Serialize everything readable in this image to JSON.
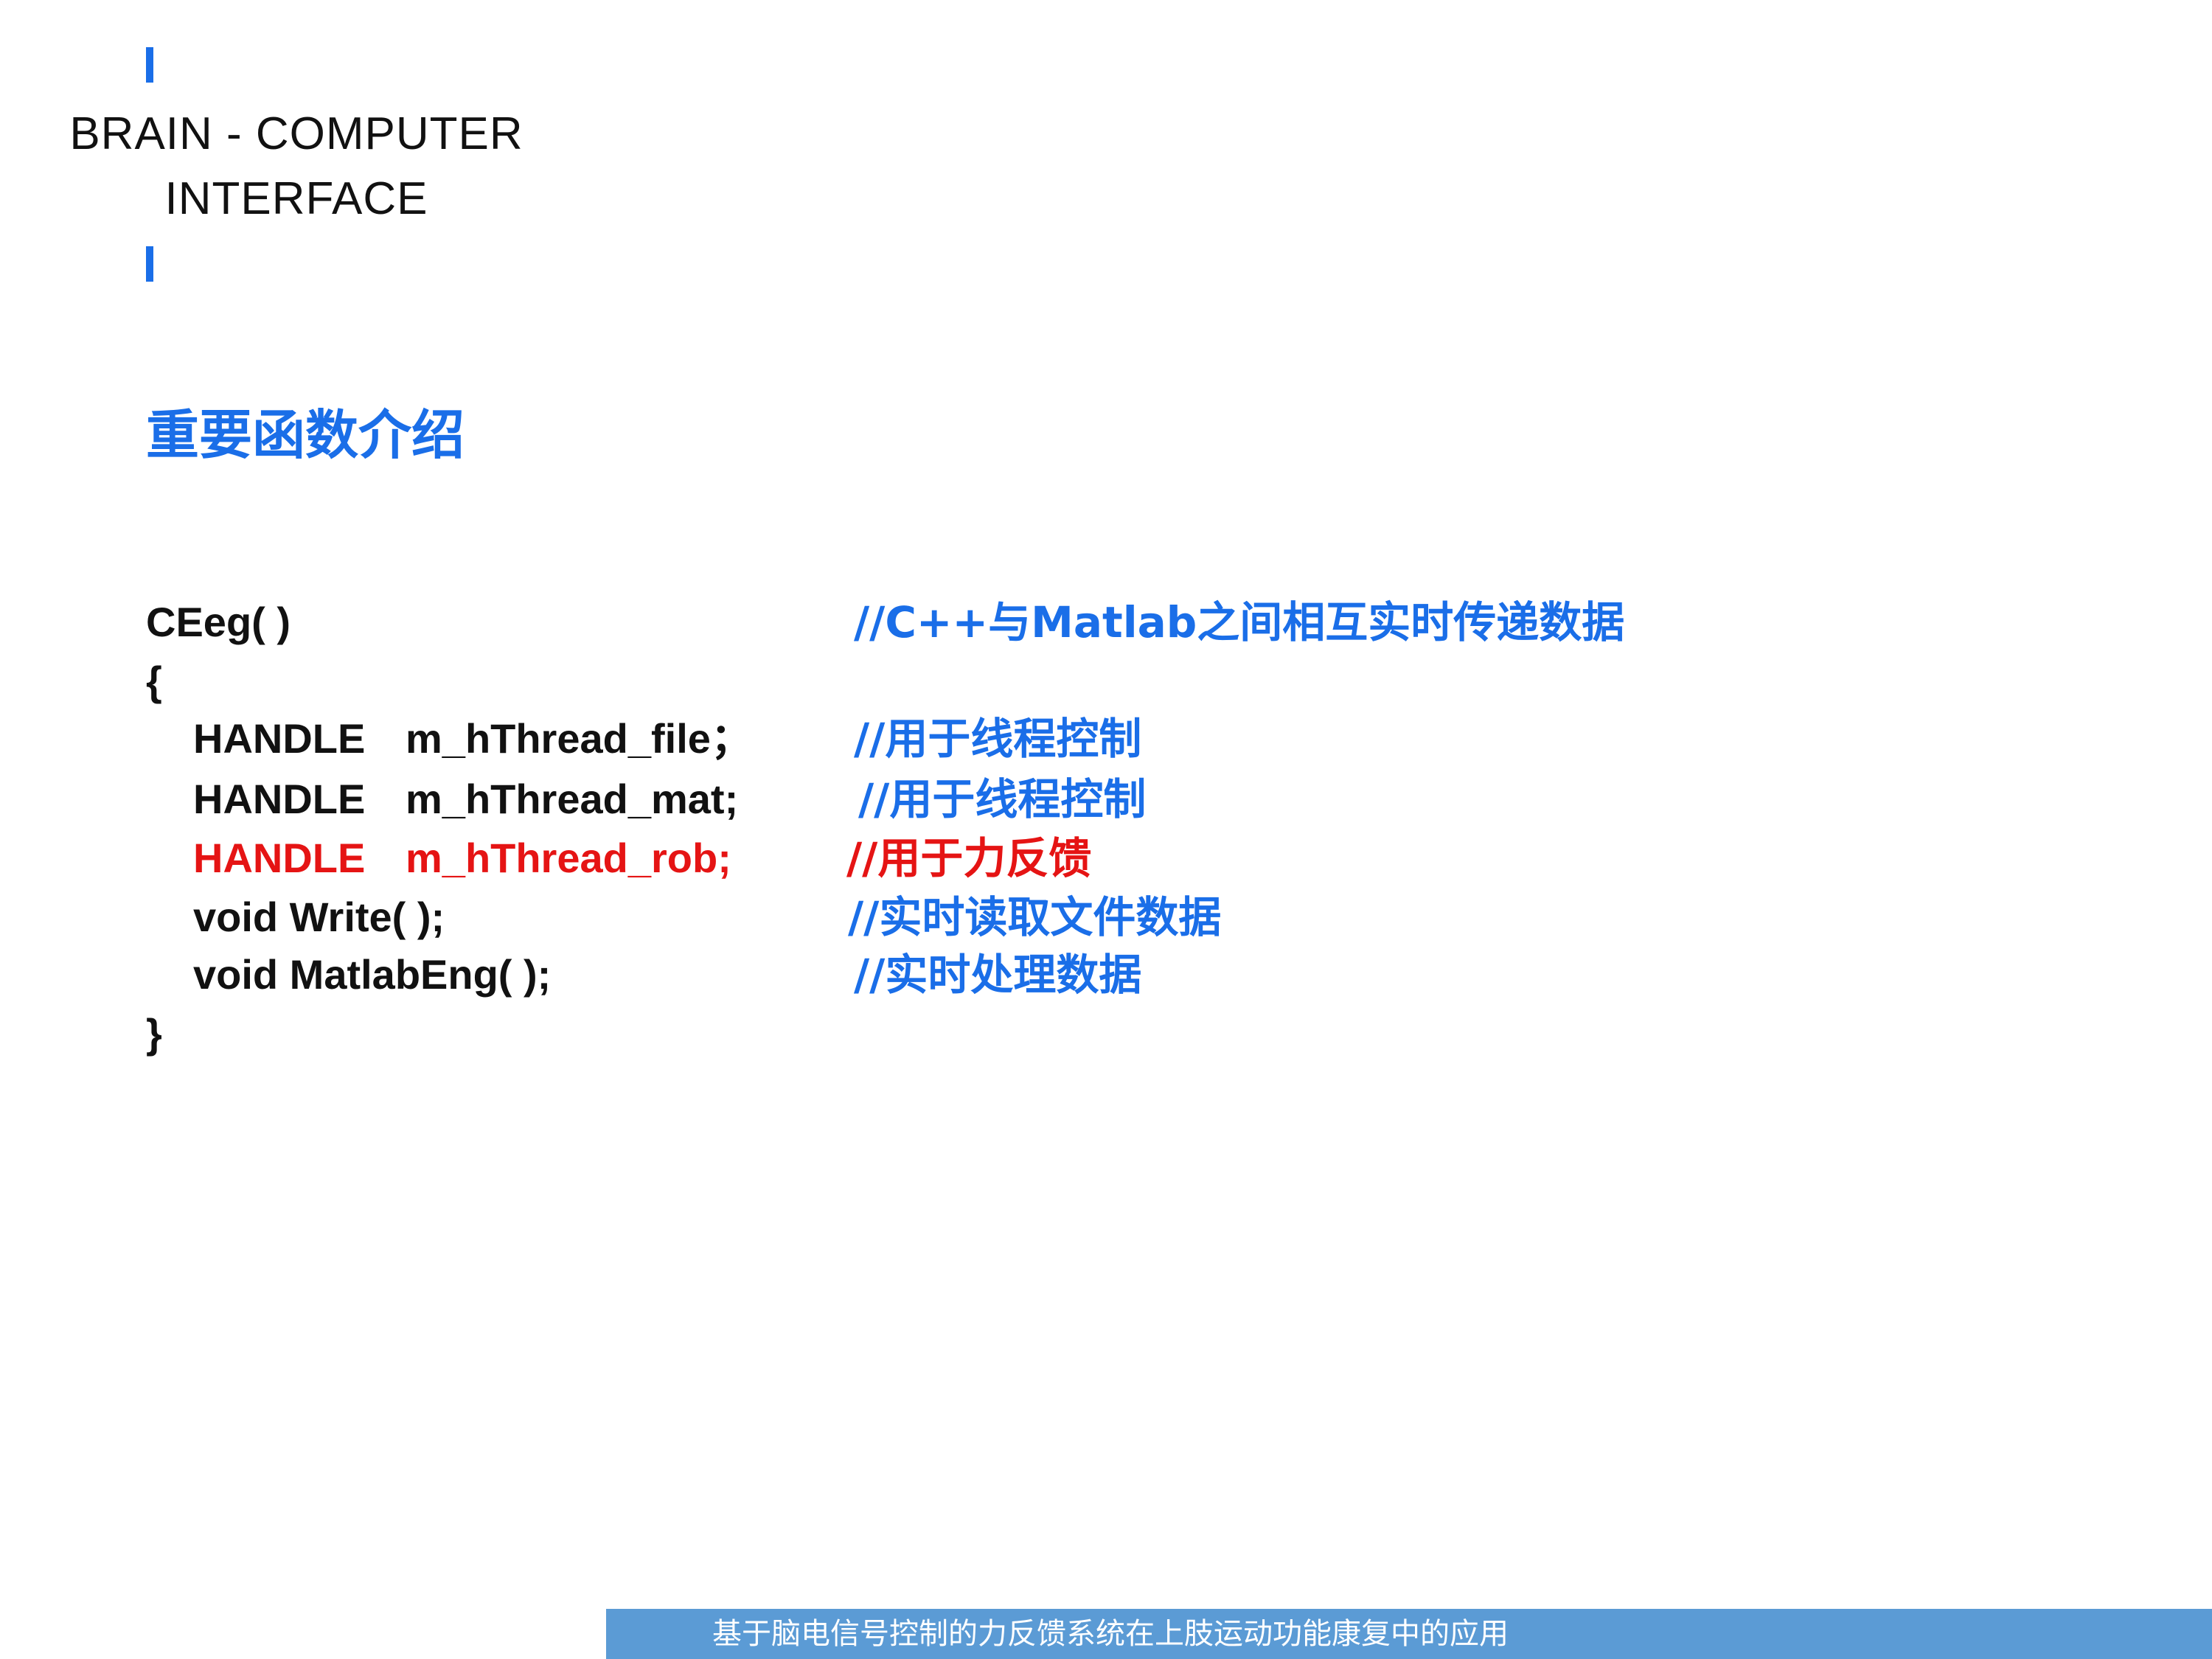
{
  "header": {
    "brand_line1": "BRAIN - COMPUTER",
    "brand_line2": "INTERFACE"
  },
  "section": {
    "title": "重要函数介绍"
  },
  "code": {
    "lines": [
      {
        "text": "CEeg( )",
        "comment": "//C++与Matlab之间相互实时传递数据"
      },
      {
        "text": "{",
        "comment": ""
      },
      {
        "keyword": "HANDLE",
        "member": "m_hThread_file；",
        "comment": "//用于线程控制"
      },
      {
        "keyword": "HANDLE",
        "member": "m_hThread_mat;",
        "comment": "//用于线程控制"
      },
      {
        "keyword": "HANDLE",
        "member": "m_hThread_rob;",
        "comment": "//用于力反馈",
        "highlight": "#e51414"
      },
      {
        "text": "void Write( );",
        "comment": "//实时读取文件数据"
      },
      {
        "text": "void MatlabEng( );",
        "comment": "//实时处理数据"
      },
      {
        "text": "}",
        "comment": ""
      }
    ]
  },
  "footer": {
    "caption": "基于脑电信号控制的力反馈系统在上肢运动功能康复中的应用"
  },
  "colors": {
    "accent": "#1a6ee8",
    "highlight": "#e51414",
    "footer_band": "#5b9bd5"
  }
}
